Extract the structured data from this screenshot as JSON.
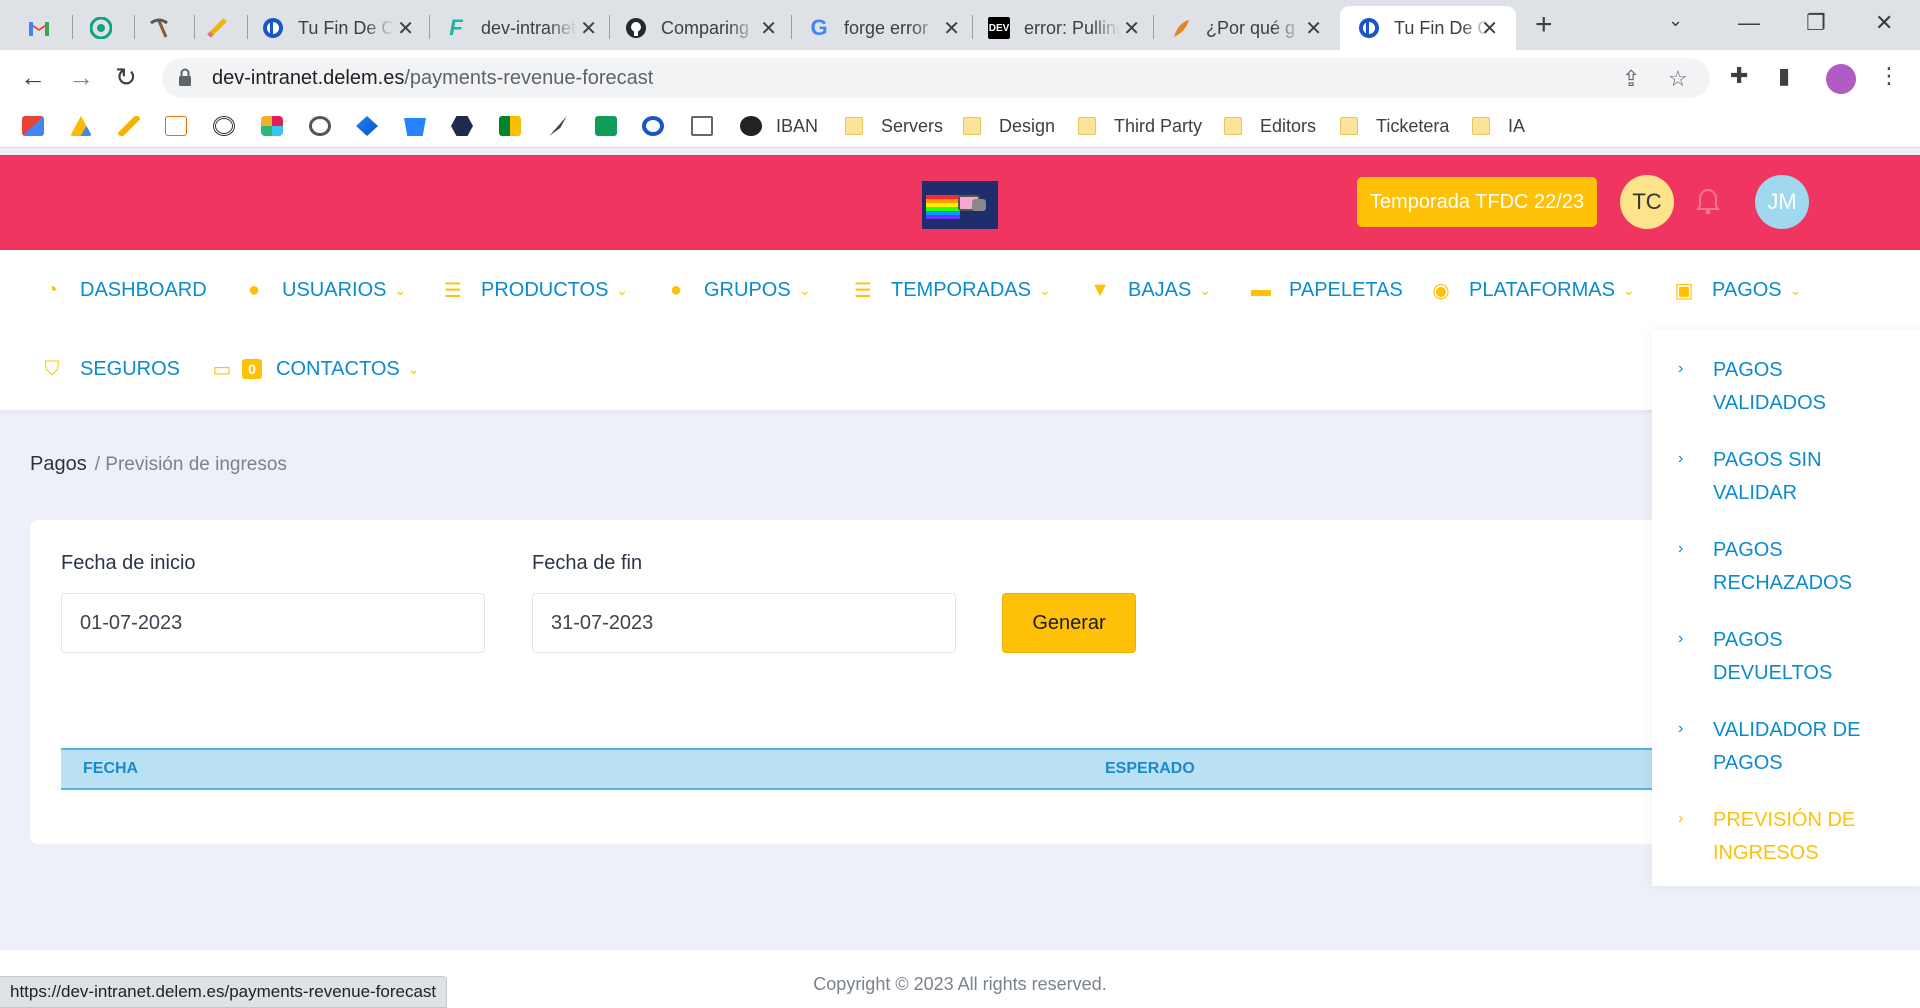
{
  "browser": {
    "tabs": [
      {
        "title": "",
        "icon": "gmail-icon",
        "color": "#ea4335"
      },
      {
        "title": "",
        "icon": "chatgpt-icon",
        "color": "#10a37f"
      },
      {
        "title": "",
        "icon": "pickaxe-icon",
        "color": "#8b5a2b"
      },
      {
        "title": "",
        "icon": "pencil-icon",
        "color": "#f4b400"
      },
      {
        "title": "Tu Fin De Curso",
        "icon": "tfdc-icon",
        "color": "#1a56c8"
      },
      {
        "title": "dev-intranet",
        "icon": "forge-icon",
        "color": "#1bb5a0"
      },
      {
        "title": "Comparing",
        "icon": "github-icon",
        "color": "#24292e"
      },
      {
        "title": "forge error",
        "icon": "google-icon",
        "color": "#4285f4"
      },
      {
        "title": "error: Pulling",
        "icon": "dev-icon",
        "color": "#000000"
      },
      {
        "title": "¿Por qué g",
        "icon": "feather-icon",
        "color": "#e0861a"
      },
      {
        "title": "Tu Fin De C",
        "icon": "tfdc-icon",
        "color": "#1a56c8",
        "active": true
      }
    ],
    "url_domain": "dev-intranet.delem.es",
    "url_path": "/payments-revenue-forecast",
    "bookmarks": [
      "IBAN",
      "Servers",
      "Design",
      "Third Party",
      "Editors",
      "Ticketera",
      "IA"
    ],
    "status_url": "https://dev-intranet.delem.es/payments-revenue-forecast"
  },
  "header": {
    "season": "Temporada TFDC 22/23",
    "avatar_left": "TC",
    "avatar_right": "JM"
  },
  "menu": {
    "dashboard": "DASHBOARD",
    "usuarios": "USUARIOS",
    "productos": "PRODUCTOS",
    "grupos": "GRUPOS",
    "temporadas": "TEMPORADAS",
    "bajas": "BAJAS",
    "papeletas": "PAPELETAS",
    "plataformas": "PLATAFORMAS",
    "pagos": "PAGOS",
    "seguros": "SEGUROS",
    "contactos": "CONTACTOS",
    "contactos_badge": "0"
  },
  "pagos_dropdown": [
    {
      "line1": "PAGOS",
      "line2": "VALIDADOS"
    },
    {
      "line1": "PAGOS SIN",
      "line2": "VALIDAR"
    },
    {
      "line1": "PAGOS",
      "line2": "RECHAZADOS"
    },
    {
      "line1": "PAGOS",
      "line2": "DEVUELTOS"
    },
    {
      "line1": "VALIDADOR DE",
      "line2": "PAGOS"
    },
    {
      "line1": "PREVISIÓN DE",
      "line2": "INGRESOS",
      "active": true
    }
  ],
  "breadcrumb": {
    "root": "Pagos",
    "current": "/ Previsión de ingresos"
  },
  "form": {
    "start_label": "Fecha de inicio",
    "start_value": "01-07-2023",
    "end_label": "Fecha de fin",
    "end_value": "31-07-2023",
    "generate": "Generar"
  },
  "table": {
    "col_fecha": "FECHA",
    "col_esperado": "ESPERADO"
  },
  "footer": {
    "copyright": "Copyright © 2023 All rights reserved."
  },
  "colors": {
    "brand_header": "#ef3560",
    "accent_yellow": "#ffc107",
    "link_blue": "#0a8bd0",
    "table_header": "#b9e0f3"
  }
}
